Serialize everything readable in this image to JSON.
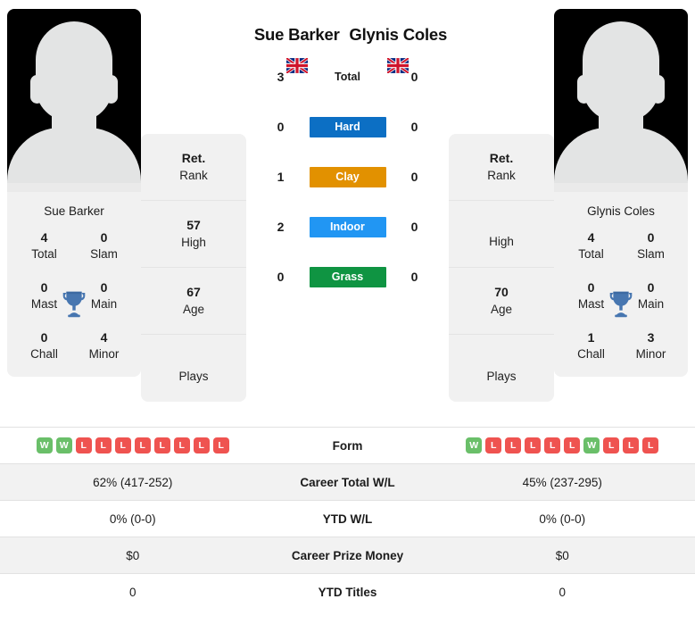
{
  "players": {
    "left": {
      "name": "Sue Barker",
      "photo_caption": "Sue Barker",
      "flag": "gb-flag-icon",
      "titles": [
        {
          "value": "4",
          "label": "Total"
        },
        {
          "value": "0",
          "label": "Slam"
        },
        {
          "value": "0",
          "label": "Mast"
        },
        {
          "value": "0",
          "label": "Main"
        },
        {
          "value": "0",
          "label": "Chall"
        },
        {
          "value": "4",
          "label": "Minor"
        }
      ],
      "stats": [
        {
          "value": "Ret.",
          "label": "Rank"
        },
        {
          "value": "57",
          "label": "High"
        },
        {
          "value": "67",
          "label": "Age"
        },
        {
          "value": "",
          "label": "Plays"
        }
      ],
      "form": [
        "W",
        "W",
        "L",
        "L",
        "L",
        "L",
        "L",
        "L",
        "L",
        "L"
      ]
    },
    "right": {
      "name": "Glynis Coles",
      "photo_caption": "Glynis Coles",
      "flag": "gb-flag-icon",
      "titles": [
        {
          "value": "4",
          "label": "Total"
        },
        {
          "value": "0",
          "label": "Slam"
        },
        {
          "value": "0",
          "label": "Mast"
        },
        {
          "value": "0",
          "label": "Main"
        },
        {
          "value": "1",
          "label": "Chall"
        },
        {
          "value": "3",
          "label": "Minor"
        }
      ],
      "stats": [
        {
          "value": "Ret.",
          "label": "Rank"
        },
        {
          "value": "",
          "label": "High"
        },
        {
          "value": "70",
          "label": "Age"
        },
        {
          "value": "",
          "label": "Plays"
        }
      ],
      "form": [
        "W",
        "L",
        "L",
        "L",
        "L",
        "L",
        "W",
        "L",
        "L",
        "L"
      ]
    }
  },
  "head_to_head": [
    {
      "label": "Total",
      "left": "3",
      "right": "0",
      "color": null,
      "pill": false
    },
    {
      "label": "Hard",
      "left": "0",
      "right": "0",
      "color": "#0c6fc4",
      "pill": true
    },
    {
      "label": "Clay",
      "left": "1",
      "right": "0",
      "color": "#e29100",
      "pill": true
    },
    {
      "label": "Indoor",
      "left": "2",
      "right": "0",
      "color": "#2196f3",
      "pill": true
    },
    {
      "label": "Grass",
      "left": "0",
      "right": "0",
      "color": "#0f9442",
      "pill": true
    }
  ],
  "stats_rows": [
    {
      "label": "Form",
      "left": "",
      "right": "",
      "is_form": true,
      "shaded": false
    },
    {
      "label": "Career Total W/L",
      "left": "62% (417-252)",
      "right": "45% (237-295)",
      "is_form": false,
      "shaded": true
    },
    {
      "label": "YTD W/L",
      "left": "0% (0-0)",
      "right": "0% (0-0)",
      "is_form": false,
      "shaded": false
    },
    {
      "label": "Career Prize Money",
      "left": "$0",
      "right": "$0",
      "is_form": false,
      "shaded": true
    },
    {
      "label": "YTD Titles",
      "left": "0",
      "right": "0",
      "is_form": false,
      "shaded": false
    }
  ],
  "icons": {
    "trophy": "trophy-icon"
  },
  "colors": {
    "hard": "#0c6fc4",
    "clay": "#e29100",
    "indoor": "#2196f3",
    "grass": "#0f9442",
    "win_badge": "#6abf69",
    "loss_badge": "#ef5350",
    "card_bg": "#f1f1f1",
    "row_shade": "#f2f2f2"
  }
}
